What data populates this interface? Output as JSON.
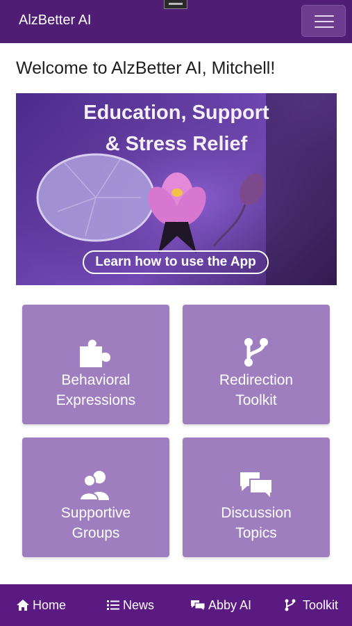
{
  "header": {
    "brand": "AlzBetter AI",
    "menu_icon": "hamburger-menu-icon"
  },
  "welcome": "Welcome to AlzBetter AI, Mitchell!",
  "banner": {
    "title_line1": "Education, Support",
    "title_line2": "& Stress Relief",
    "button_label": "Learn how to use the App"
  },
  "tiles": [
    {
      "line1": "Behavioral",
      "line2": "Expressions",
      "icon": "puzzle-piece-icon"
    },
    {
      "line1": "Redirection",
      "line2": "Toolkit",
      "icon": "code-branch-icon"
    },
    {
      "line1": "Supportive",
      "line2": "Groups",
      "icon": "users-icon"
    },
    {
      "line1": "Discussion",
      "line2": "Topics",
      "icon": "comments-icon"
    }
  ],
  "bottom_nav": [
    {
      "label": "Home",
      "icon": "home-icon"
    },
    {
      "label": "News",
      "icon": "list-icon"
    },
    {
      "label": "Abby AI",
      "icon": "comments-icon"
    },
    {
      "label": "Toolkit",
      "icon": "code-branch-icon"
    }
  ],
  "colors": {
    "header_bg": "#4f1d74",
    "tile_bg": "#9f7ec0",
    "bottom_nav_bg": "#5a1a82"
  }
}
